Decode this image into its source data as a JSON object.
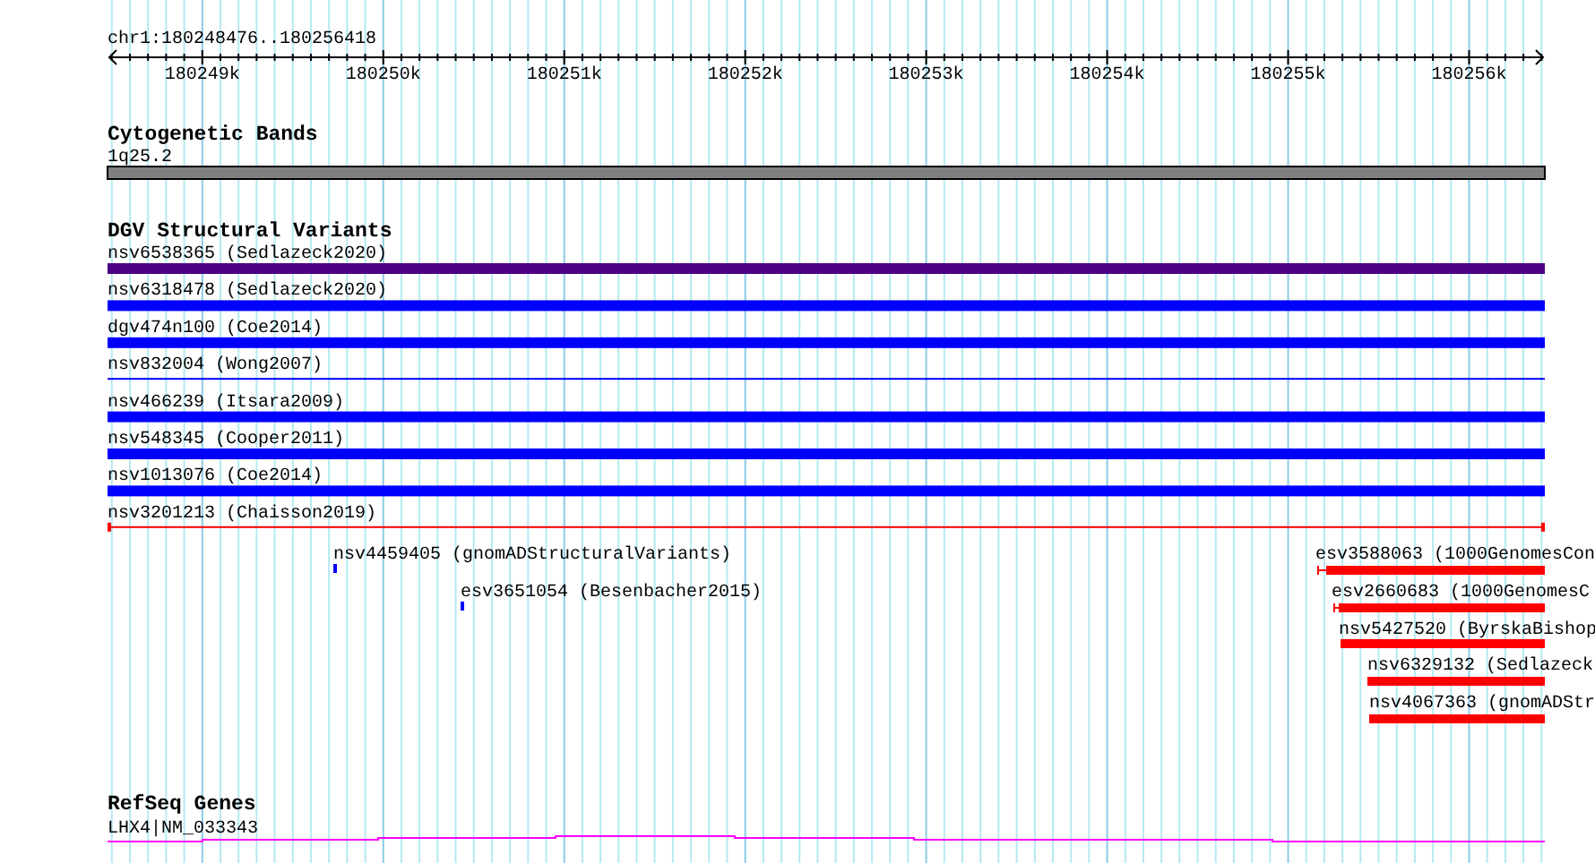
{
  "ruler": {
    "range": "chr1:180248476..180256418",
    "ticks": [
      "180249k",
      "180250k",
      "180251k",
      "180252k",
      "180253k",
      "180254k",
      "180255k",
      "180256k"
    ]
  },
  "tracks": [
    {
      "kind": "band",
      "title": "Cytogenetic Bands",
      "features": [
        {
          "label": "1q25.2",
          "color": "#808080"
        }
      ]
    },
    {
      "kind": "variants",
      "title": "DGV Structural Variants",
      "features": [
        {
          "label": "nsv6538365 (Sedlazeck2020)",
          "kind": "bar",
          "color": "#4b0082"
        },
        {
          "label": "nsv6318478 (Sedlazeck2020)",
          "kind": "bar",
          "color": "#0000ff"
        },
        {
          "label": "dgv474n100 (Coe2014)",
          "kind": "bar",
          "color": "#0000ff"
        },
        {
          "label": "nsv832004 (Wong2007)",
          "kind": "line",
          "color": "#0000ff"
        },
        {
          "label": "nsv466239 (Itsara2009)",
          "kind": "bar",
          "color": "#0000ff"
        },
        {
          "label": "nsv548345 (Cooper2011)",
          "kind": "bar",
          "color": "#0000ff"
        },
        {
          "label": "nsv1013076 (Coe2014)",
          "kind": "bar",
          "color": "#0000ff"
        },
        {
          "label": "nsv3201213 (Chaisson2019)",
          "kind": "span",
          "color": "#ff0000"
        },
        {
          "label": "nsv4459405 (gnomADStructuralVariants)",
          "kind": "bar",
          "color": "#0000ff"
        },
        {
          "label": "esv3651054 (Besenbacher2015)",
          "kind": "bar",
          "color": "#0000ff"
        },
        {
          "label": "esv3588063 (1000GenomesCon",
          "kind": "bar",
          "color": "#ff0000"
        },
        {
          "label": "esv2660683 (1000GenomesC",
          "kind": "bar",
          "color": "#ff0000"
        },
        {
          "label": "nsv5427520 (ByrskaBishop",
          "kind": "bar",
          "color": "#ff0000"
        },
        {
          "label": "nsv6329132 (Sedlazeck",
          "kind": "bar",
          "color": "#ff0000"
        },
        {
          "label": "nsv4067363 (gnomADStr",
          "kind": "bar",
          "color": "#ff0000"
        }
      ]
    },
    {
      "kind": "gene",
      "title": "RefSeq Genes",
      "features": [
        {
          "label": "LHX4|NM_033343",
          "color": "#ff00ff"
        }
      ]
    }
  ]
}
